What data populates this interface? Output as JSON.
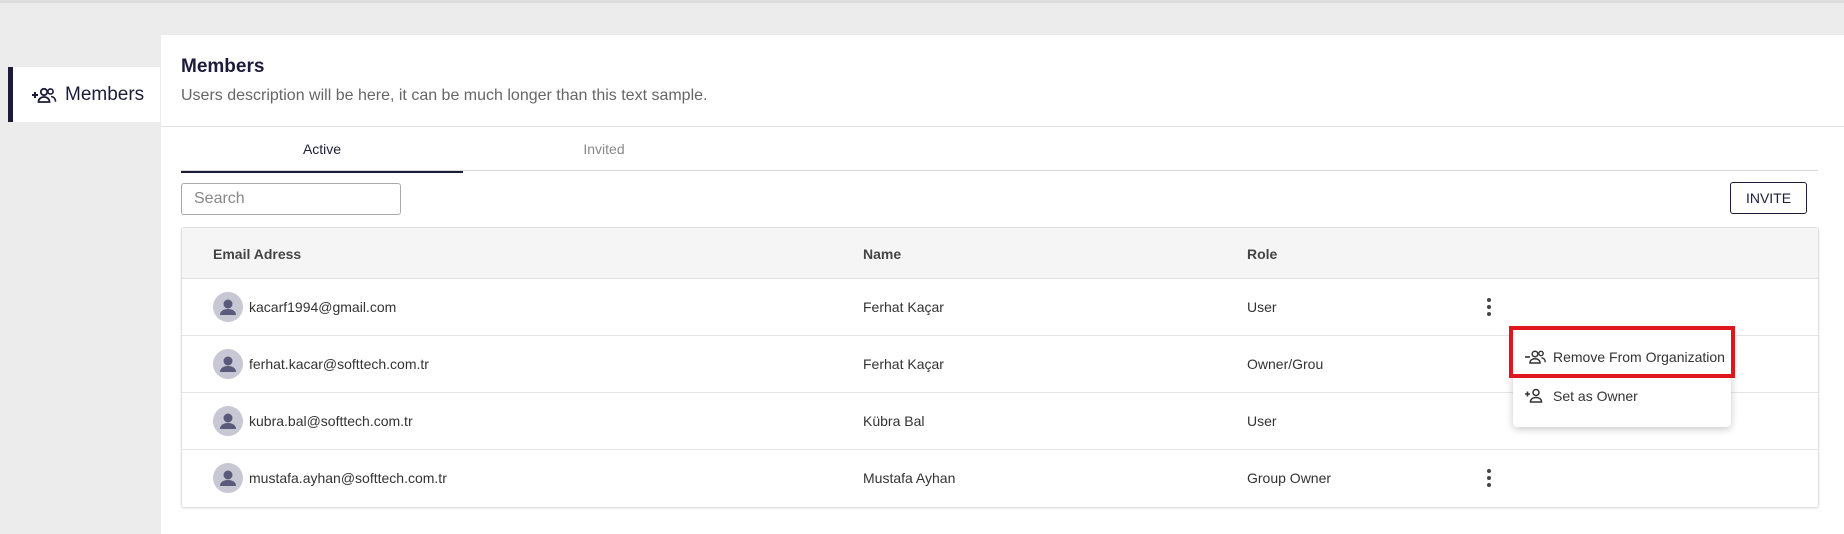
{
  "sidebar": {
    "items": [
      {
        "label": "Members",
        "icon": "add-group-icon",
        "active": true
      }
    ]
  },
  "header": {
    "title": "Members",
    "description": "Users description will be here, it can be much longer than this text sample."
  },
  "tabs": [
    {
      "label": "Active",
      "active": true
    },
    {
      "label": "Invited",
      "active": false
    }
  ],
  "search": {
    "placeholder": "Search",
    "value": ""
  },
  "invite_label": "INVITE",
  "table": {
    "columns": [
      "Email Adress",
      "Name",
      "Role"
    ],
    "rows": [
      {
        "email": "kacarf1994@gmail.com",
        "name": "Ferhat Kaçar",
        "role": "User"
      },
      {
        "email": "ferhat.kacar@softtech.com.tr",
        "name": "Ferhat Kaçar",
        "role": "Owner/Grou"
      },
      {
        "email": "kubra.bal@softtech.com.tr",
        "name": "Kübra Bal",
        "role": "User"
      },
      {
        "email": "mustafa.ayhan@softtech.com.tr",
        "name": "Mustafa Ayhan",
        "role": "Group Owner"
      }
    ]
  },
  "context_menu": {
    "items": [
      {
        "label": "Remove From Organization",
        "icon": "remove-user-icon"
      },
      {
        "label": "Set as Owner",
        "icon": "add-user-icon"
      }
    ]
  },
  "colors": {
    "primary": "#1c1c3a",
    "highlight": "#e0161e",
    "background": "#ececec",
    "avatar": "#c8c8d4"
  }
}
